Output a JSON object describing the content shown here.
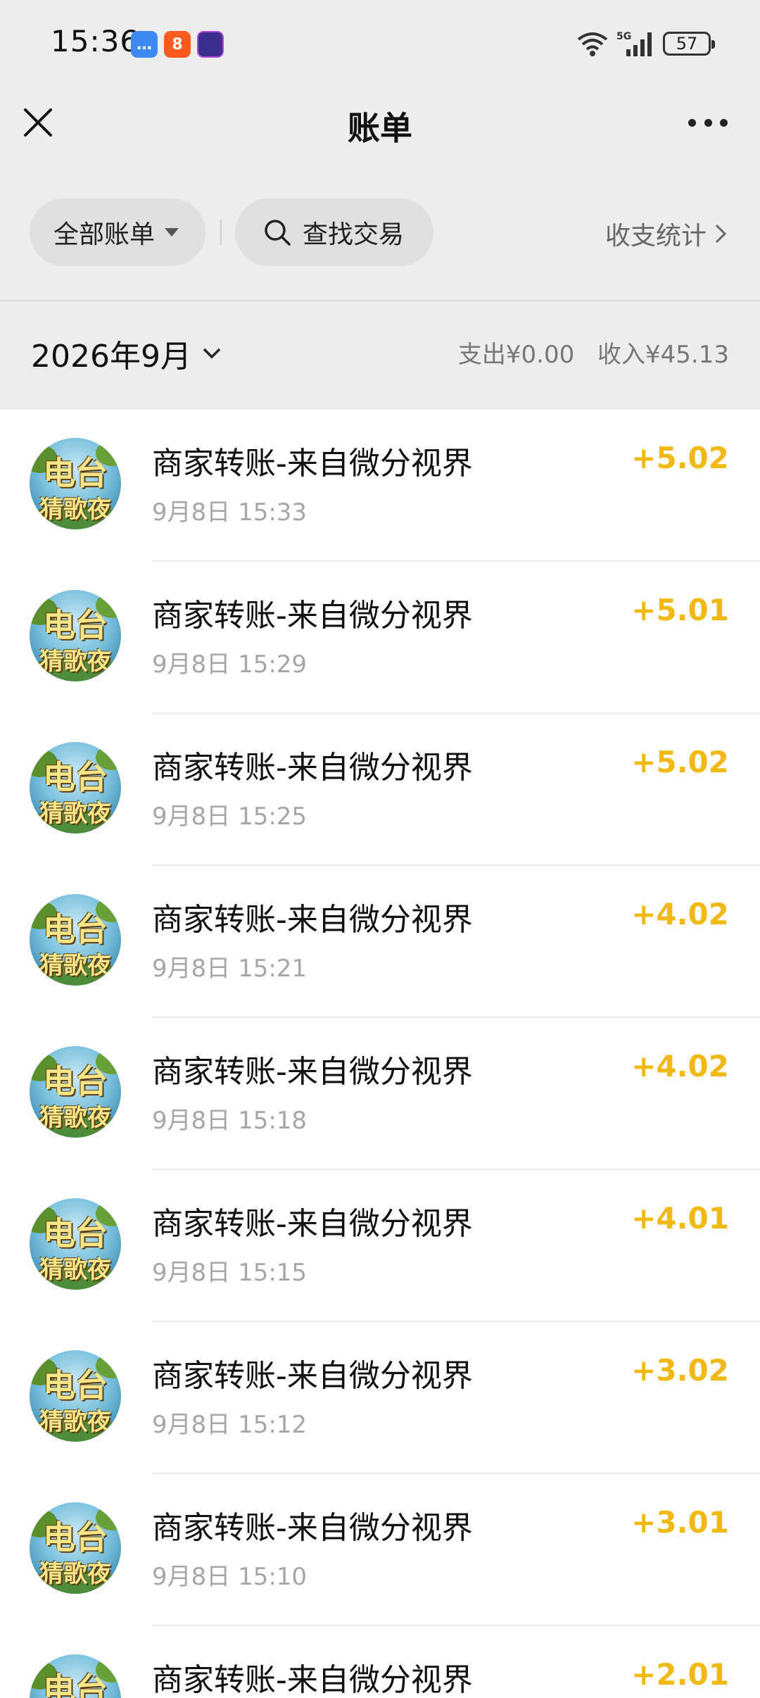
{
  "status_bar": {
    "time": "15:36",
    "battery": "57",
    "icons": [
      "message-app-icon",
      "kuaishou-app-icon",
      "game-app-icon",
      "wifi-icon",
      "5g-signal-icon",
      "battery-icon"
    ]
  },
  "nav": {
    "title": "账单",
    "close_icon": "close-icon",
    "more_icon": "more-icon"
  },
  "filters": {
    "all_bills": "全部账单",
    "search": "查找交易",
    "stats": "收支统计"
  },
  "month": {
    "label": "2026年9月",
    "expense": "支出¥0.00",
    "income": "收入¥45.13"
  },
  "avatar_text": {
    "line1": "电台",
    "line2": "猜歌夜"
  },
  "transactions": [
    {
      "title": "商家转账-来自微分视界",
      "time": "9月8日 15:33",
      "amount": "+5.02"
    },
    {
      "title": "商家转账-来自微分视界",
      "time": "9月8日 15:29",
      "amount": "+5.01"
    },
    {
      "title": "商家转账-来自微分视界",
      "time": "9月8日 15:25",
      "amount": "+5.02"
    },
    {
      "title": "商家转账-来自微分视界",
      "time": "9月8日 15:21",
      "amount": "+4.02"
    },
    {
      "title": "商家转账-来自微分视界",
      "time": "9月8日 15:18",
      "amount": "+4.02"
    },
    {
      "title": "商家转账-来自微分视界",
      "time": "9月8日 15:15",
      "amount": "+4.01"
    },
    {
      "title": "商家转账-来自微分视界",
      "time": "9月8日 15:12",
      "amount": "+3.02"
    },
    {
      "title": "商家转账-来自微分视界",
      "time": "9月8日 15:10",
      "amount": "+3.01"
    },
    {
      "title": "商家转账-来自微分视界",
      "time": "",
      "amount": "+2.01"
    }
  ],
  "colors": {
    "amount": "#f1b914",
    "header_bg": "#ededed"
  }
}
